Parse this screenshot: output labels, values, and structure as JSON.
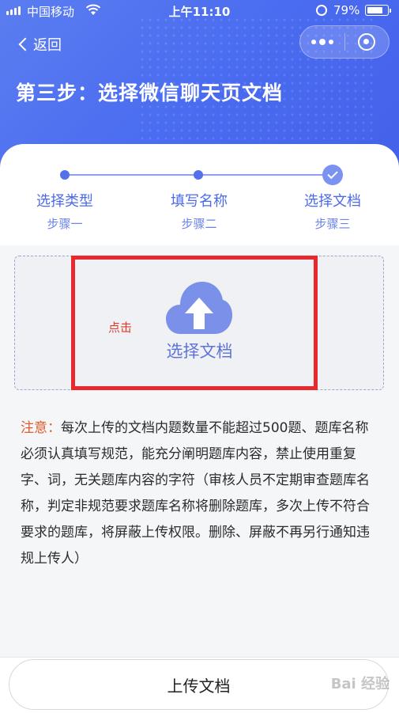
{
  "status_bar": {
    "carrier": "中国移动",
    "time": "上午11:10",
    "battery_percent": "79%",
    "battery_level": 0.79
  },
  "nav": {
    "back_label": "返回"
  },
  "header": {
    "title": "第三步：选择微信聊天页文档"
  },
  "steps": [
    {
      "title": "选择类型",
      "sub": "步骤一"
    },
    {
      "title": "填写名称",
      "sub": "步骤二"
    },
    {
      "title": "选择文档",
      "sub": "步骤三"
    }
  ],
  "upload": {
    "label": "选择文档",
    "annotation": "点击",
    "icon": "cloud-upload-icon"
  },
  "notice": {
    "label": "注意：",
    "text": "每次上传的文档内题数量不能超过500题、题库名称必须认真填写规范，能充分阐明题库内容，禁止使用重复字、词，无关题库内容的字符（审核人员不定期审查题库名称，判定非规范要求题库名称将删除题库，多次上传不符合要求的题库，将屏蔽上传权限。删除、屏蔽不再另行通知违规上传人）"
  },
  "footer": {
    "upload_button": "上传文档",
    "watermark": "Bai 经验"
  },
  "colors": {
    "accent": "#4a6cf0",
    "highlight": "#e8282d",
    "notice_label": "#e05a2b"
  }
}
